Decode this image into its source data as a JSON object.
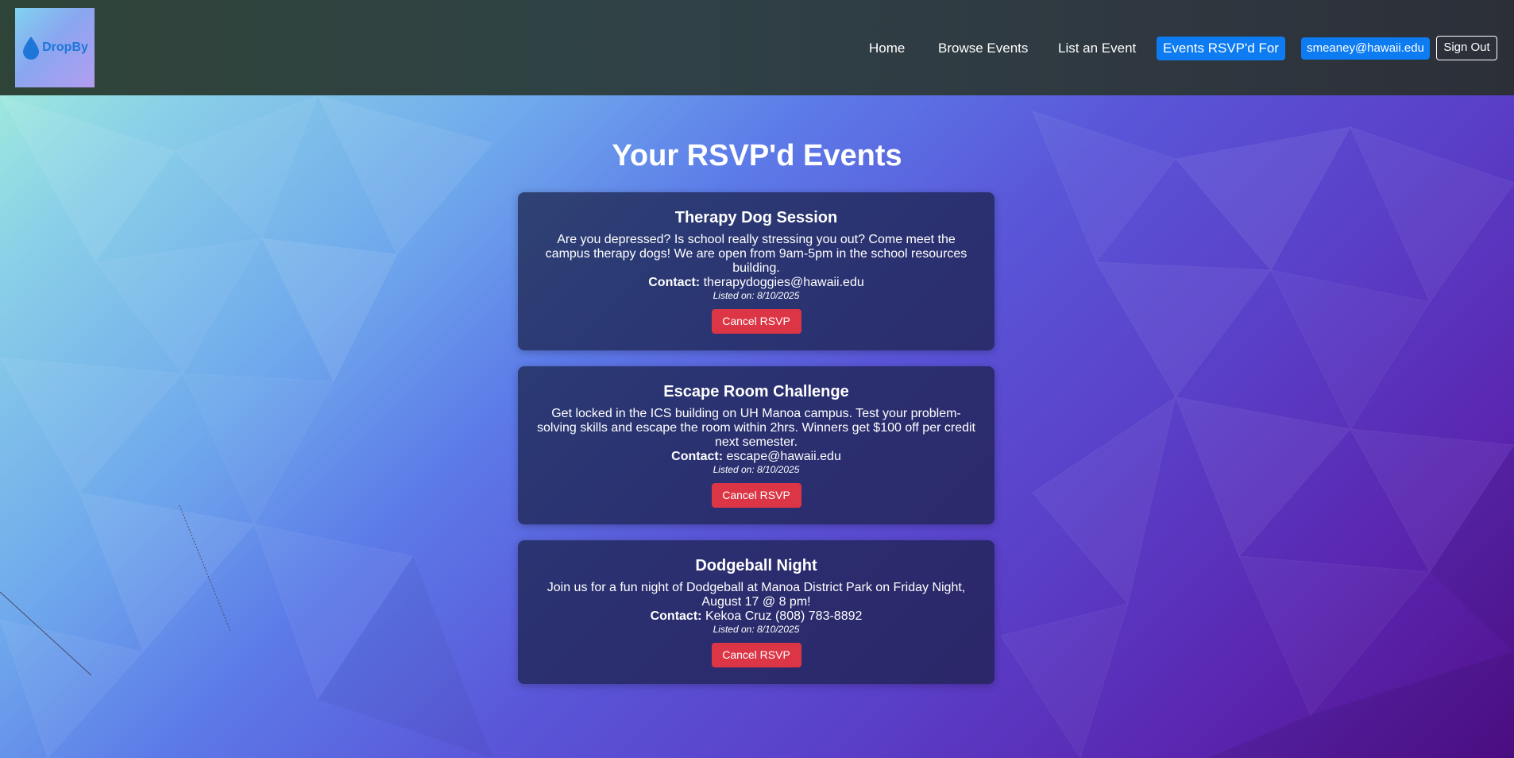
{
  "brand": {
    "name": "DropBy"
  },
  "nav": {
    "home": "Home",
    "browse": "Browse Events",
    "list": "List an Event",
    "rsvpd": "Events RSVP'd For",
    "user": "smeaney@hawaii.edu",
    "signout": "Sign Out"
  },
  "page": {
    "title": "Your RSVP'd Events"
  },
  "contact_label": "Contact:",
  "events": [
    {
      "title": "Therapy Dog Session",
      "description": "Are you depressed? Is school really stressing you out? Come meet the campus therapy dogs! We are open from 9am-5pm in the school resources building.",
      "contact": "therapydoggies@hawaii.edu",
      "listed": "Listed on: 8/10/2025",
      "button": "Cancel RSVP"
    },
    {
      "title": "Escape Room Challenge",
      "description": "Get locked in the ICS building on UH Manoa campus. Test your problem-solving skills and escape the room within 2hrs. Winners get $100 off per credit next semester.",
      "contact": "escape@hawaii.edu",
      "listed": "Listed on: 8/10/2025",
      "button": "Cancel RSVP"
    },
    {
      "title": "Dodgeball Night",
      "description": "Join us for a fun night of Dodgeball at Manoa District Park on Friday Night, August 17 @ 8 pm!",
      "contact": "Kekoa Cruz (808) 783-8892",
      "listed": "Listed on: 8/10/2025",
      "button": "Cancel RSVP"
    }
  ],
  "colors": {
    "primary": "#0d7bf2",
    "danger": "#dc3545",
    "navbar": "#2f3f3e"
  }
}
